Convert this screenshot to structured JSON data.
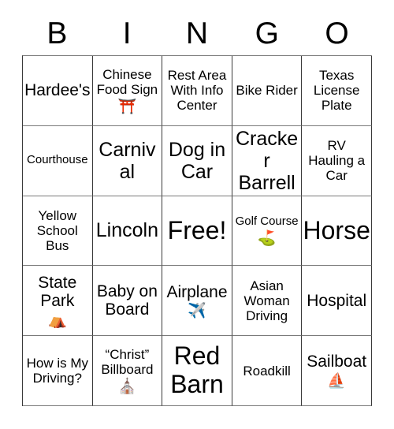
{
  "header": {
    "letters": [
      "B",
      "I",
      "N",
      "G",
      "O"
    ]
  },
  "grid": {
    "rows": 5,
    "columns": 5,
    "border_color": "#3a3a3a",
    "background_color": "#ffffff",
    "text_color": "#000000",
    "cells": [
      [
        {
          "text": "Hardee's",
          "emoji": ""
        },
        {
          "text": "Chinese Food Sign",
          "emoji": "⛩️",
          "emoji_name": "torii-gate-emoji"
        },
        {
          "text": "Rest Area With Info Center",
          "emoji": ""
        },
        {
          "text": "Bike Rider",
          "emoji": ""
        },
        {
          "text": "Texas License Plate",
          "emoji": ""
        }
      ],
      [
        {
          "text": "Courthouse",
          "emoji": ""
        },
        {
          "text": "Carnival",
          "emoji": ""
        },
        {
          "text": "Dog in Car",
          "emoji": ""
        },
        {
          "text": "Cracker Barrell",
          "emoji": ""
        },
        {
          "text": "RV Hauling a Car",
          "emoji": ""
        }
      ],
      [
        {
          "text": "Yellow School Bus",
          "emoji": ""
        },
        {
          "text": "Lincoln",
          "emoji": ""
        },
        {
          "text": "Free!",
          "emoji": ""
        },
        {
          "text": "Golf Course",
          "emoji": "⛳",
          "emoji_name": "golf-flag-emoji"
        },
        {
          "text": "Horse",
          "emoji": ""
        }
      ],
      [
        {
          "text": "State Park",
          "emoji": "⛺",
          "emoji_name": "tent-emoji"
        },
        {
          "text": "Baby on Board",
          "emoji": ""
        },
        {
          "text": "Airplane",
          "emoji": "✈️",
          "emoji_name": "airplane-emoji"
        },
        {
          "text": "Asian Woman Driving",
          "emoji": ""
        },
        {
          "text": "Hospital",
          "emoji": ""
        }
      ],
      [
        {
          "text": "How is My Driving?",
          "emoji": ""
        },
        {
          "text": "“Christ” Billboard",
          "emoji": "⛪",
          "emoji_name": "church-emoji"
        },
        {
          "text": "Red Barn",
          "emoji": ""
        },
        {
          "text": "Roadkill",
          "emoji": ""
        },
        {
          "text": "Sailboat",
          "emoji": "⛵",
          "emoji_name": "sailboat-emoji"
        }
      ]
    ]
  }
}
